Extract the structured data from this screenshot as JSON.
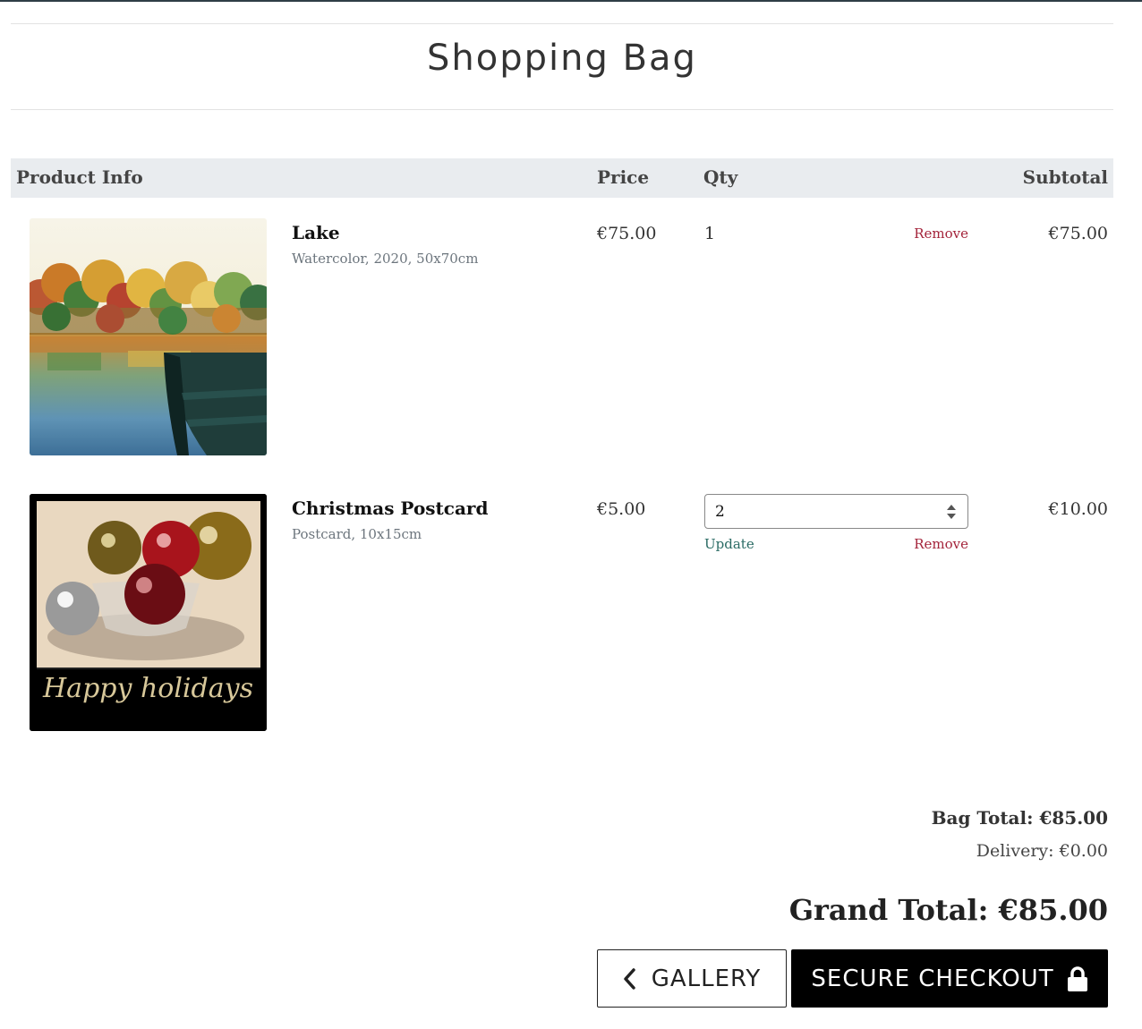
{
  "page": {
    "title": "Shopping Bag"
  },
  "table": {
    "headers": {
      "product_info": "Product Info",
      "price": "Price",
      "qty": "Qty",
      "subtotal": "Subtotal"
    },
    "rows": [
      {
        "name": "Lake",
        "details": "Watercolor, 2020, 50x70cm",
        "price": "€75.00",
        "qty": "1",
        "remove_label": "Remove",
        "subtotal": "€75.00",
        "image_icon": "watercolor-lake-boat-image"
      },
      {
        "name": "Christmas Postcard",
        "details": "Postcard, 10x15cm",
        "price": "€5.00",
        "qty": "2",
        "update_label": "Update",
        "remove_label": "Remove",
        "subtotal": "€10.00",
        "image_caption": "Happy holidays",
        "image_icon": "christmas-baubles-postcard-image"
      }
    ]
  },
  "totals": {
    "bag_total": "Bag Total: €85.00",
    "delivery": "Delivery: €0.00",
    "grand_total": "Grand Total: €85.00"
  },
  "buttons": {
    "gallery_label": "GALLERY",
    "gallery_icon": "chevron-left-icon",
    "checkout_label": "SECURE CHECKOUT",
    "checkout_icon": "lock-icon"
  },
  "colors": {
    "header_bg": "#e9ecef",
    "remove": "#a4243b",
    "update": "#2a6b64",
    "checkout_bg": "#000000"
  }
}
